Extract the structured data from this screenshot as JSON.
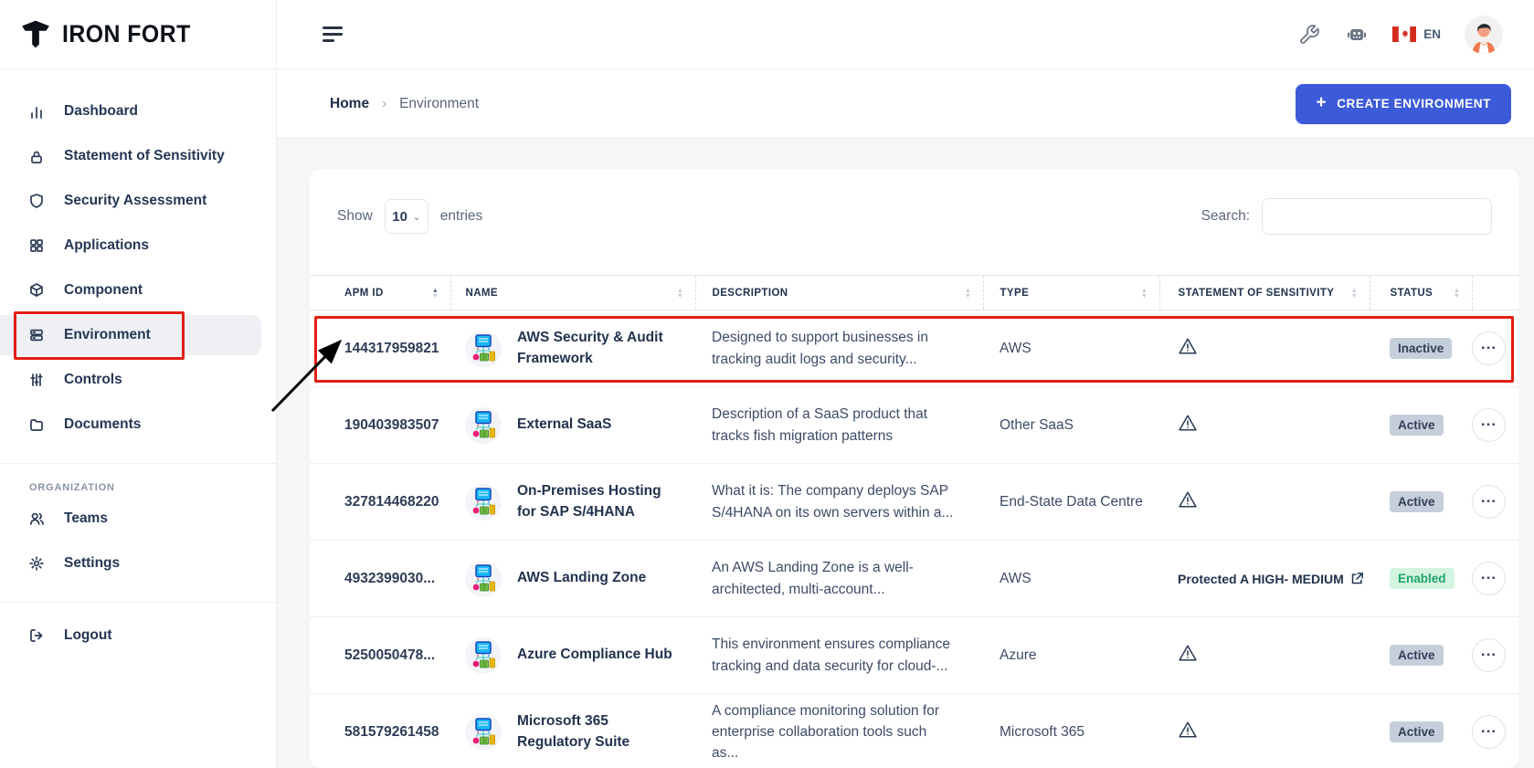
{
  "brand": {
    "name": "IRON FORT"
  },
  "sidebar": {
    "items": [
      {
        "label": "Dashboard"
      },
      {
        "label": "Statement of Sensitivity"
      },
      {
        "label": "Security Assessment"
      },
      {
        "label": "Applications"
      },
      {
        "label": "Component"
      },
      {
        "label": "Environment"
      },
      {
        "label": "Controls"
      },
      {
        "label": "Documents"
      }
    ],
    "section_label": "ORGANIZATION",
    "org_items": [
      {
        "label": "Teams"
      },
      {
        "label": "Settings"
      }
    ],
    "logout_label": "Logout"
  },
  "header": {
    "language": "EN"
  },
  "breadcrumb": {
    "home": "Home",
    "separator": "›",
    "current": "Environment"
  },
  "actions": {
    "create_button": "CREATE ENVIRONMENT",
    "create_plus": "+"
  },
  "table_controls": {
    "show_label": "Show",
    "page_size": "10",
    "entries_label": "entries",
    "search_label": "Search:"
  },
  "table": {
    "columns": [
      "APM ID",
      "NAME",
      "DESCRIPTION",
      "TYPE",
      "STATEMENT OF SENSITIVITY",
      "STATUS"
    ],
    "actions_label": "...",
    "rows": [
      {
        "apm_id": "144317959821",
        "name": "AWS Security & Audit Framework",
        "description": "Designed to support businesses in tracking audit logs and security...",
        "type": "AWS",
        "sos": "warning",
        "status": "Inactive",
        "status_variant": "gray",
        "annotated": true
      },
      {
        "apm_id": "190403983507",
        "name": "External SaaS",
        "description": "Description of a SaaS product that tracks fish migration patterns",
        "type": "Other SaaS",
        "sos": "warning",
        "status": "Active",
        "status_variant": "gray"
      },
      {
        "apm_id": "327814468220",
        "name": "On-Premises Hosting for SAP S/4HANA",
        "description": "What it is: The company deploys SAP S/4HANA on its own servers within a...",
        "type": "End-State Data Centre",
        "sos": "warning",
        "status": "Active",
        "status_variant": "gray"
      },
      {
        "apm_id": "4932399030...",
        "name": "AWS Landing Zone",
        "description": "An AWS Landing Zone is a well-architected, multi-account...",
        "type": "AWS",
        "sos": "protected",
        "sos_text": "Protected A HIGH- MEDIUM",
        "status": "Enabled",
        "status_variant": "green"
      },
      {
        "apm_id": "5250050478...",
        "name": "Azure Compliance Hub",
        "description": "This environment ensures compliance tracking and data security for cloud-...",
        "type": "Azure",
        "sos": "warning",
        "status": "Active",
        "status_variant": "gray"
      },
      {
        "apm_id": "581579261458",
        "name": "Microsoft 365 Regulatory Suite",
        "description": "A compliance monitoring solution for enterprise collaboration tools such as...",
        "type": "Microsoft 365",
        "sos": "warning",
        "status": "Active",
        "status_variant": "gray"
      }
    ]
  },
  "colors": {
    "accent_blue": "#3c5bd9",
    "annotation_red": "#e21d12",
    "badge_gray_bg": "#c6cedb",
    "badge_green_bg": "#d3f4e1",
    "badge_green_text": "#1ea566",
    "flag_red": "#d52b1e"
  }
}
